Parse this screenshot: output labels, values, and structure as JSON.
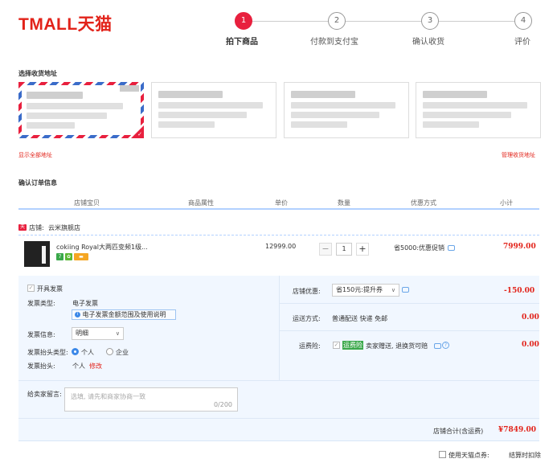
{
  "logo": "TMALL天猫",
  "steps": [
    {
      "num": "1",
      "label": "拍下商品",
      "active": true
    },
    {
      "num": "2",
      "label": "付款到支付宝",
      "active": false
    },
    {
      "num": "3",
      "label": "确认收货",
      "active": false
    },
    {
      "num": "4",
      "label": "评价",
      "active": false
    }
  ],
  "address": {
    "section_title": "选择收货地址",
    "show_all": "显示全部地址",
    "manage": "管理收货地址"
  },
  "order": {
    "section_title": "确认订单信息",
    "columns": [
      "店铺宝贝",
      "商品属性",
      "单价",
      "数量",
      "优惠方式",
      "小计"
    ],
    "store_prefix": "店铺:",
    "store_name": "云米旗舰店",
    "product": {
      "name": "cokiing Royal大两匹变频1级...",
      "unit_price": "12999.00",
      "quantity": "1",
      "discount": "省5000:优惠促销",
      "subtotal": "7999.00"
    }
  },
  "invoice": {
    "open_invoice": "开具发票",
    "type_label": "发票类型:",
    "type_value": "电子发票",
    "notice": "电子发票金额范围及使用说明",
    "info_label": "发票信息:",
    "info_value": "明细",
    "title_type_label": "发票抬头类型:",
    "title_type_personal": "个人",
    "title_type_company": "企业",
    "title_label": "发票抬头:",
    "title_value": "个人",
    "modify": "修改"
  },
  "message": {
    "label": "给卖家留言:",
    "placeholder": "选填, 请先和商家协商一致",
    "counter": "0/200"
  },
  "services": {
    "store_discount_label": "店铺优惠:",
    "store_discount_value": "省150元:提升券",
    "store_discount_amount": "-150.00",
    "shipping_label": "运送方式:",
    "shipping_value": "普通配送 快递 免邮",
    "shipping_amount": "0.00",
    "insurance_label": "运费险:",
    "insurance_badge": "运费险",
    "insurance_text": "卖家赠送, 退换货可赔",
    "insurance_amount": "0.00"
  },
  "total": {
    "label": "店铺合计(含运费)",
    "amount": "¥7849.00"
  },
  "footer": {
    "points_label": "使用天猫点券:",
    "points_note": "结算时扣除"
  },
  "colors": {
    "accent": "#e8203e",
    "brand_red": "#e2231a",
    "panel_bg": "#f1f7ff",
    "link_blue": "#3b88e8"
  }
}
